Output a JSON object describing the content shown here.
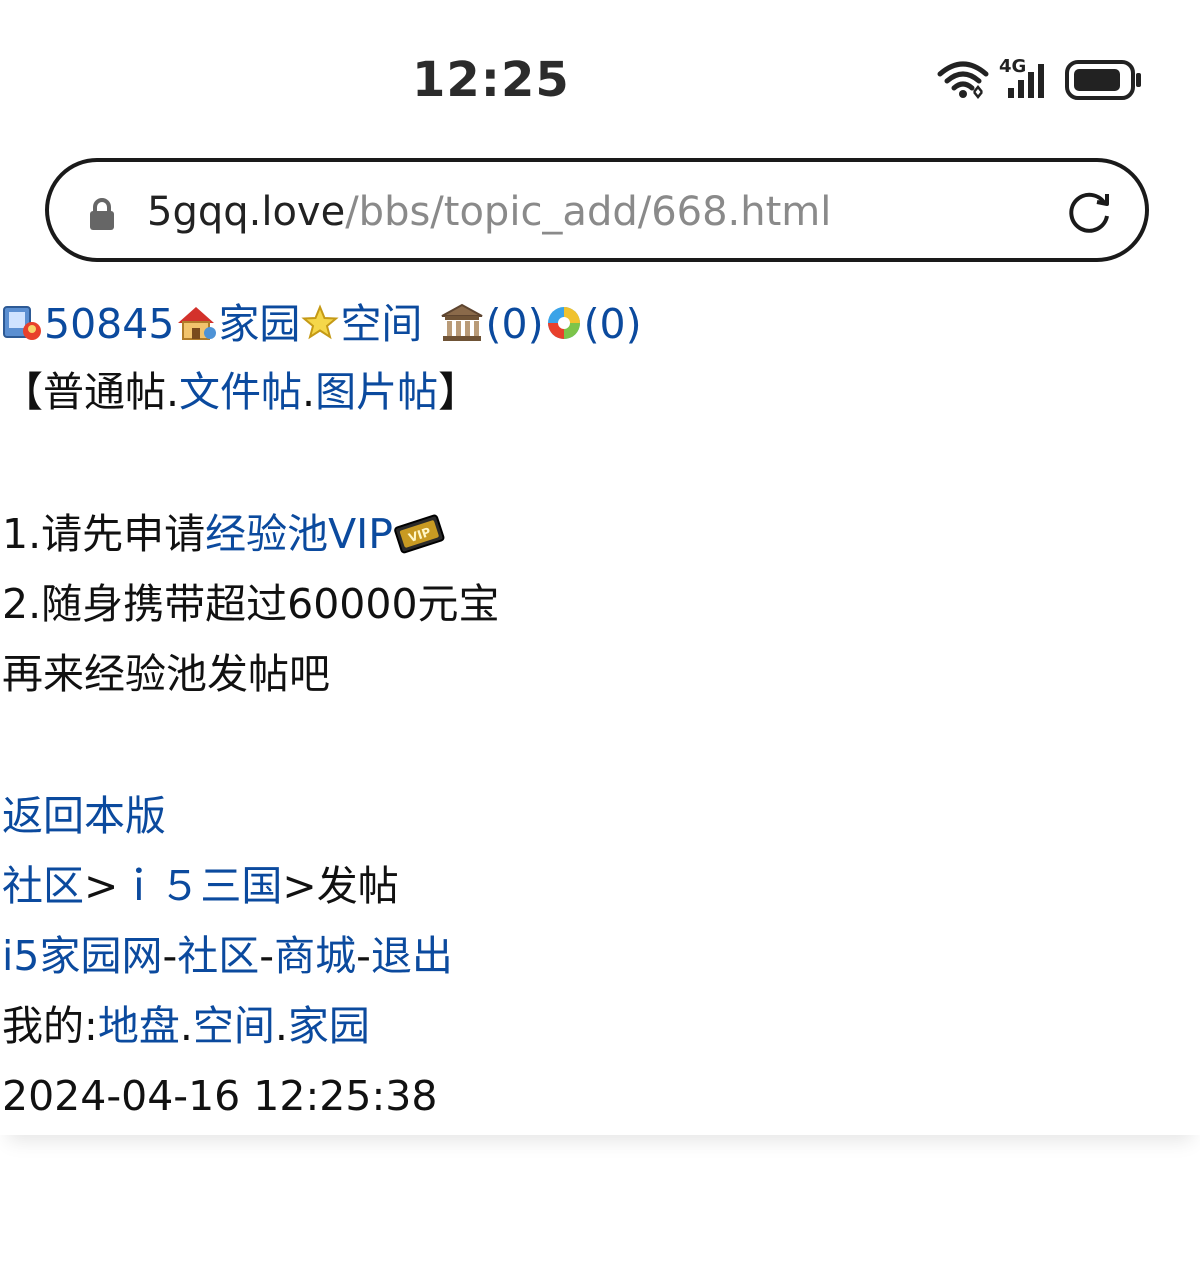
{
  "status_bar": {
    "time": "12:25",
    "network_label": "4G",
    "icons": [
      "wifi-icon",
      "cellular-signal-icon",
      "battery-icon"
    ]
  },
  "browser": {
    "url_host": "5gqq.love",
    "url_path": "/bbs/topic_add/668.html",
    "icons": [
      "lock-icon",
      "reload-icon"
    ]
  },
  "top_nav": {
    "user_id": "50845",
    "home_label": "家园",
    "space_label": "空间",
    "bank_count": "(0)",
    "color_count": "(0)"
  },
  "post_types": {
    "open_bracket": "【",
    "normal": "普通帖",
    "sep1": ".",
    "file": "文件帖",
    "sep2": ".",
    "image": "图片帖",
    "close_bracket": "】"
  },
  "notice": {
    "line1_prefix": "1.请先申请",
    "line1_link": "经验池VIP",
    "line2": "2.随身携带超过60000元宝",
    "line3": "再来经验池发帖吧"
  },
  "footer": {
    "back_link": "返回本版",
    "breadcrumb": {
      "community": "社区",
      "sep1": ">",
      "board": "ｉ５三国",
      "sep2": ">",
      "current": "发帖"
    },
    "site_links": {
      "home": "i5家园网",
      "sep1": "-",
      "community": "社区",
      "sep2": "-",
      "mall": "商城",
      "sep3": "-",
      "logout": "退出"
    },
    "mine": {
      "label": "我的:",
      "territory": "地盘",
      "sep1": ".",
      "space": "空间",
      "sep2": ".",
      "home": "家园"
    },
    "timestamp": "2024-04-16 12:25:38"
  },
  "colors": {
    "link": "#0b4a9e",
    "text": "#111111",
    "url_path": "#8a8a8a"
  }
}
